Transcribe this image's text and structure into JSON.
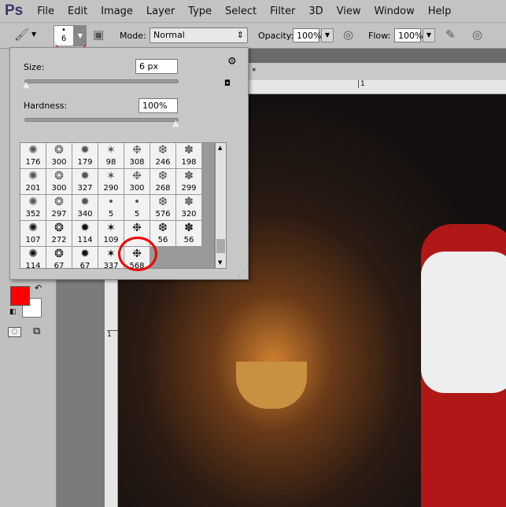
{
  "app": {
    "logo": "Ps",
    "menu": [
      "File",
      "Edit",
      "Image",
      "Layer",
      "Type",
      "Select",
      "Filter",
      "3D",
      "View",
      "Window",
      "Help"
    ]
  },
  "options": {
    "brush_size": "6",
    "mode_label": "Mode:",
    "mode_value": "Normal",
    "opacity_label": "Opacity:",
    "opacity_value": "100%",
    "flow_label": "Flow:",
    "flow_value": "100%"
  },
  "brush_panel": {
    "size_label": "Size:",
    "size_value": "6 px",
    "hardness_label": "Hardness:",
    "hardness_value": "100%",
    "size_fraction": 0.02,
    "hardness_fraction": 1.0,
    "presets": [
      "176",
      "300",
      "179",
      "98",
      "308",
      "246",
      "198",
      "201",
      "300",
      "327",
      "290",
      "300",
      "268",
      "299",
      "352",
      "297",
      "340",
      "5",
      "5",
      "576",
      "320",
      "107",
      "272",
      "114",
      "109",
      "",
      "56",
      "56",
      "114",
      "67",
      "67",
      "337",
      "568"
    ]
  },
  "document": {
    "tab_marker": "*",
    "ruler_h": "1",
    "ruler_v": "1"
  },
  "colors": {
    "foreground": "#ff0000",
    "background": "#ffffff",
    "annotation": "#e00000"
  }
}
